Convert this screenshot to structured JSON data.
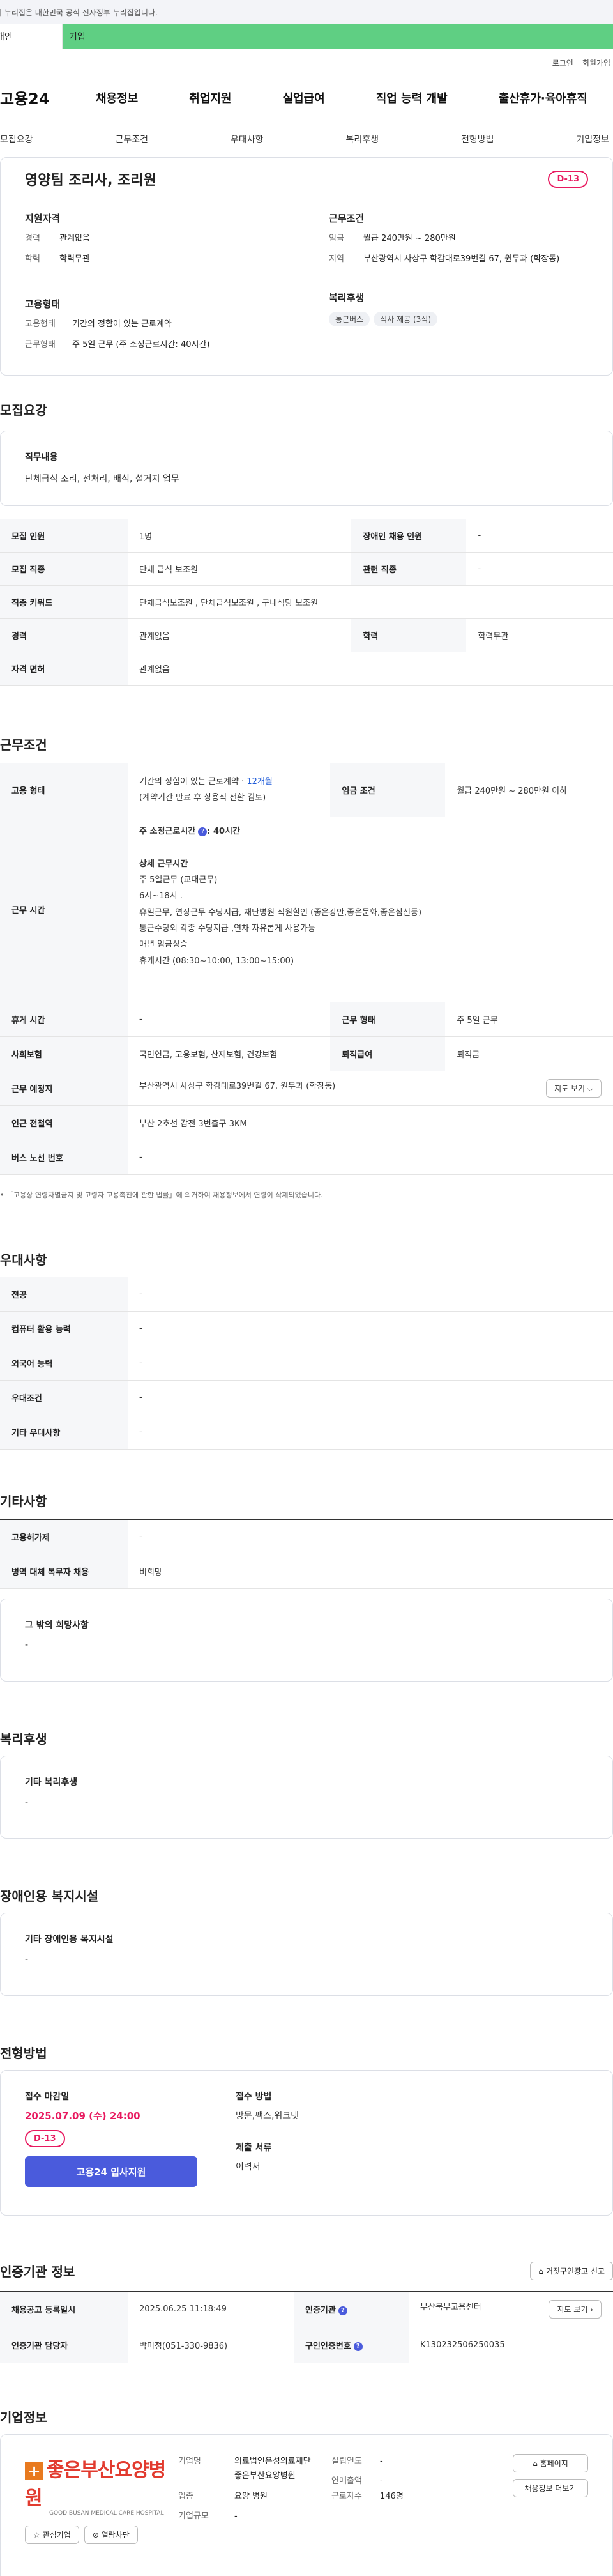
{
  "gov_banner": "이 누리집은 대한민국 공식 전자정부 누리집입니다.",
  "env_tabs": [
    "개인",
    "기업"
  ],
  "util_links": [
    "로그인",
    "회원가입"
  ],
  "logo": "고용24",
  "gnb": [
    "채용정보",
    "취업지원",
    "실업급여",
    "직업 능력 개발",
    "출산휴가·육아휴직"
  ],
  "subnav": [
    "모집요강",
    "근무조건",
    "우대사항",
    "복리후생",
    "전형방법",
    "기업정보"
  ],
  "summary": {
    "title": "영양팀 조리사, 조리원",
    "dday": "D-13",
    "qual_h": "지원자격",
    "qual": [
      {
        "k": "경력",
        "v": "관계없음"
      },
      {
        "k": "학력",
        "v": "학력무관"
      }
    ],
    "emp_h": "고용형태",
    "emp": [
      {
        "k": "고용형태",
        "v": "기간의 정함이 있는 근로계약"
      },
      {
        "k": "근무형태",
        "v": "주 5일 근무 (주 소정근로시간: 40시간)"
      }
    ],
    "cond_h": "근무조건",
    "cond": [
      {
        "k": "임금",
        "v": "월급 240만원 ~ 280만원"
      },
      {
        "k": "지역",
        "v": "부산광역시 사상구 학감대로39번길 67, 원무과 (학장동)"
      }
    ],
    "welfare_h": "복리후생",
    "welfare_tags": [
      "통근버스",
      "식사 제공 (3식)"
    ]
  },
  "recruit": {
    "title": "모집요강",
    "duty_label": "직무내용",
    "duty_value": "단체급식 조리, 전처리, 배식, 설거지 업무",
    "rows": [
      {
        "k1": "모집 인원",
        "v1": "1명",
        "k2": "장애인 채용 인원",
        "v2": "-"
      },
      {
        "k1": "모집 직종",
        "v1": "단체 급식 보조원",
        "k2": "관련 직종",
        "v2": "-"
      },
      {
        "k1": "직종 키워드",
        "v1": "단체급식보조원 , 단체급식보조원 , 구내식당 보조원"
      },
      {
        "k1": "경력",
        "v1": "관계없음",
        "k2": "학력",
        "v2": "학력무관"
      },
      {
        "k1": "자격 면허",
        "v1": "관계없음"
      }
    ]
  },
  "work": {
    "title": "근무조건",
    "emp_type_k": "고용 형태",
    "emp_type_v1": "기간의 정함이 있는 근로계약 · ",
    "emp_type_months": "12개월",
    "emp_type_v2": "(계약기간 만료 후 상용직 전환 검토)",
    "wage_k": "임금 조건",
    "wage_v": "월급 240만원 ~ 280만원 이하",
    "hours_k": "근무 시간",
    "hours_title": "주 소정근로시간",
    "hours_val": ": 40시간",
    "hours_detail_title": "상세 근무시간",
    "hours_lines": [
      "주 5일근무 (교대근무)",
      "6시~18시 .",
      "휴일근무, 연장근무 수당지급, 재단병원 직원할인 (좋은강안,좋은문화,좋은삼선등)",
      "통근수당외 각종 수당지급 ,연차 자유롭게 사용가능",
      "매년 임금상승",
      "휴게시간 (08:30~10:00, 13:00~15:00)"
    ],
    "break_k": "휴게 시간",
    "break_v": "-",
    "form_k": "근무 형태",
    "form_v": "주 5일 근무",
    "ins_k": "사회보험",
    "ins_v": "국민연금, 고용보험, 산재보험, 건강보험",
    "sev_k": "퇴직급여",
    "sev_v": "퇴직금",
    "place_k": "근무 예정지",
    "place_v": "부산광역시 사상구 학감대로39번길 67, 원무과 (학장동)",
    "map_btn": "지도 보기",
    "station_k": "인근 전철역",
    "station_v": "부산 2호선 감전 3번출구 3KM",
    "bus_k": "버스 노선 번호",
    "bus_v": "-",
    "notice": "고용상 연령차별금지 및 고령자 고용촉진에 관한 법률」에 의거하여 채용정보에서 연령이 삭제되었습니다."
  },
  "pref": {
    "title": "우대사항",
    "rows": [
      {
        "k": "전공",
        "v": "-"
      },
      {
        "k": "컴퓨터 활용 능력",
        "v": "-"
      },
      {
        "k": "외국어 능력",
        "v": "-"
      },
      {
        "k": "우대조건",
        "v": "-"
      },
      {
        "k": "기타 우대사항",
        "v": "-"
      }
    ]
  },
  "etc": {
    "title": "기타사항",
    "rows": [
      {
        "k": "고용허가제",
        "v": "-"
      },
      {
        "k": "병역 대체 복무자 채용",
        "v": "비희망"
      }
    ],
    "card_label": "그 밖의 희망사항",
    "card_value": "-"
  },
  "benefit": {
    "title": "복리후생",
    "label": "기타 복리후생",
    "value": "-"
  },
  "disab": {
    "title": "장애인용 복지시설",
    "label": "기타 장애인용 복지시설",
    "value": "-"
  },
  "process": {
    "title": "전형방법",
    "deadline_label": "접수 마감일",
    "deadline": "2025.07.09 (수) 24:00",
    "dday": "D-13",
    "apply_btn": "고용24 입사지원",
    "method_label": "접수 방법",
    "method_value": "방문,팩스,워크넷",
    "docs_label": "제출 서류",
    "docs_value": "이력서"
  },
  "cert": {
    "title": "인증기관 정보",
    "report_btn": "거짓구인광고 신고",
    "r1k1": "채용공고 등록일시",
    "r1v1": "2025.06.25 11:18:49",
    "r1k2": "인증기관",
    "r1v2": "부산북부고용센터",
    "r1btn": "지도 보기",
    "r2k1": "인증기관 담당자",
    "r2v1": "박미정(051-330-9836)",
    "r2k2": "구인인증번호",
    "r2v2": "K130232506250035"
  },
  "company": {
    "title": "기업정보",
    "logo_text": "좋은부산요양병원",
    "logo_sub": "GOOD BUSAN MEDICAL CARE HOSPITAL",
    "interest_btn": "관심기업",
    "block_btn": "열람차단",
    "name_k": "기업명",
    "name_v": "의료법인은성의료재단좋은부산요양병원",
    "ind_k": "업종",
    "ind_v": "요양 병원",
    "size_k": "기업규모",
    "size_v": "-",
    "est_k": "설립연도",
    "est_v": "-",
    "sales_k": "연매출액",
    "sales_v": "-",
    "emp_k": "근로자수",
    "emp_v": "146명",
    "home_btn": "홈페이지",
    "jobs_btn": "채용정보 더보기"
  },
  "colors": {
    "accent": "#4a5bdc",
    "dday": "#e8195f",
    "env_tab": "#5fcf83"
  }
}
